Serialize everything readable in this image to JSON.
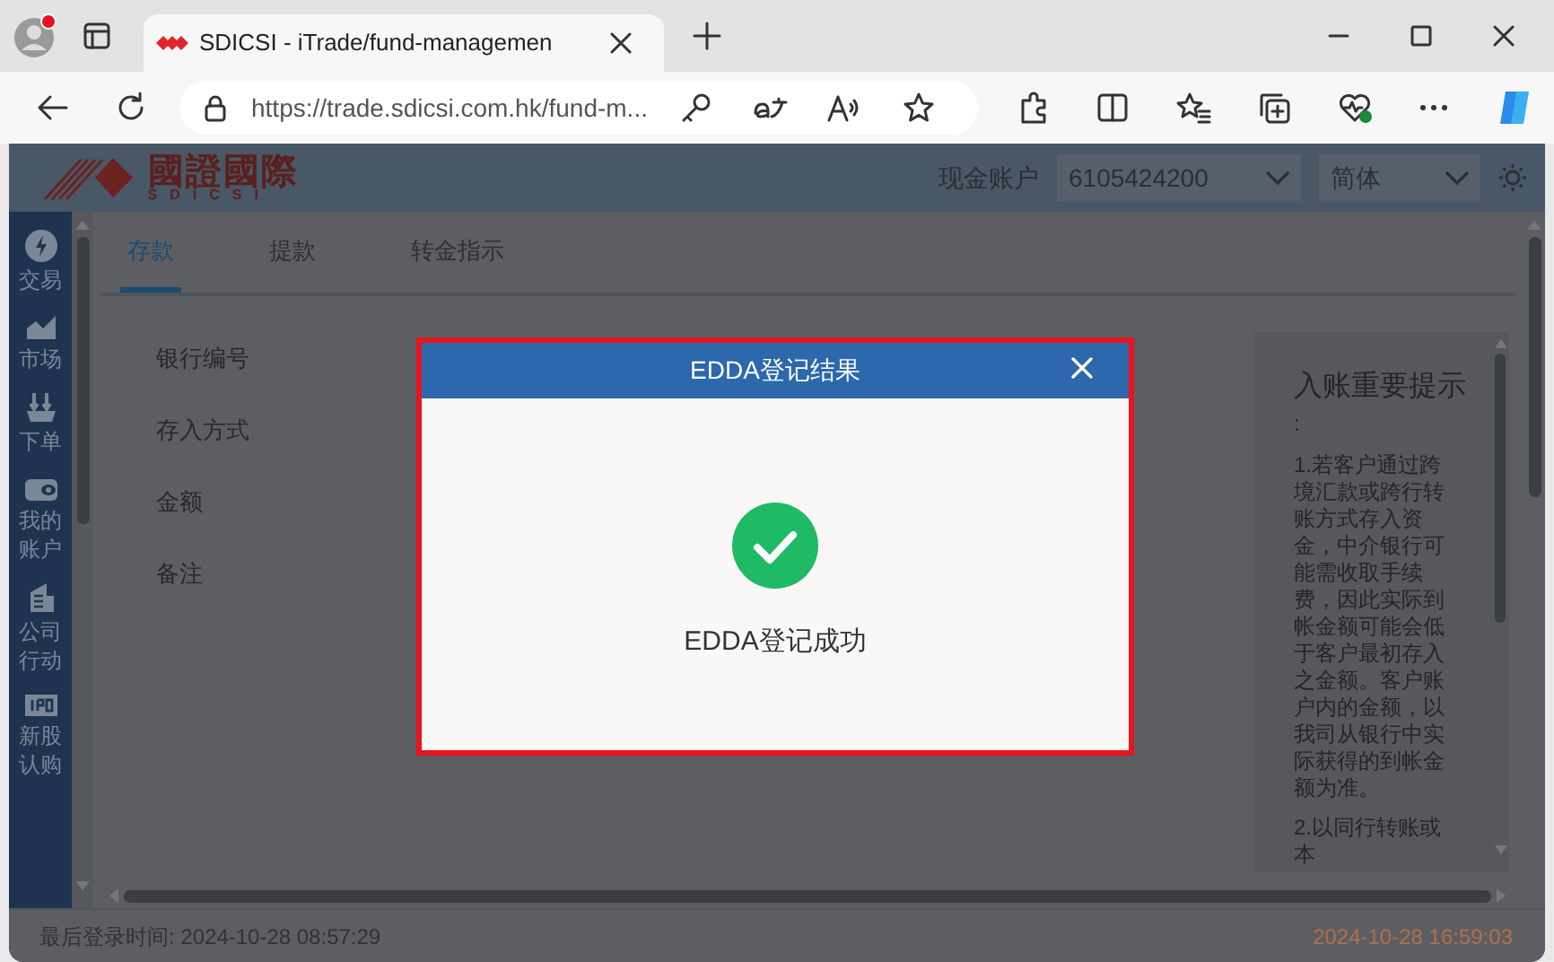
{
  "browser": {
    "tab": {
      "title": "SDICSI - iTrade/fund-managemen",
      "selected": true
    },
    "url": "https://trade.sdicsi.com.hk/fund-m..."
  },
  "header": {
    "logo_cn": "國證國際",
    "logo_en": "SDICSI",
    "account_label": "现金账户",
    "account": "6105424200",
    "language": "简体"
  },
  "nav": [
    {
      "label": "交易",
      "kind": "trade"
    },
    {
      "label": "市场",
      "kind": "market"
    },
    {
      "label": "下单",
      "kind": "order"
    },
    {
      "label": "我的账户",
      "kind": "wallet"
    },
    {
      "label": "公司行动",
      "kind": "building"
    },
    {
      "label": "新股认购",
      "kind": "ipo"
    }
  ],
  "tabs": [
    {
      "label": "存款",
      "selected": true
    },
    {
      "label": "提款",
      "selected": false
    },
    {
      "label": "转金指示",
      "selected": false
    }
  ],
  "form_labels": [
    "银行编号",
    "存入方式",
    "金额",
    "备注"
  ],
  "notice": {
    "title": "入账重要提示",
    "colon": ":",
    "paragraphs": [
      "1.若客户通过跨境汇款或跨行转账方式存入资金，中介银行可能需收取手续费，因此实际到帐金额可能会低于客户最初存入之金额。客户账户内的金额，以我司从银行中实际获得的到帐金额为准。",
      "2.以同行转账或本"
    ]
  },
  "footer": {
    "last_login": "最后登录时间: 2024-10-28 08:57:29",
    "clock": "2024-10-28 16:59:03"
  },
  "modal": {
    "title": "EDDA登记结果",
    "message": "EDDA登记成功"
  }
}
